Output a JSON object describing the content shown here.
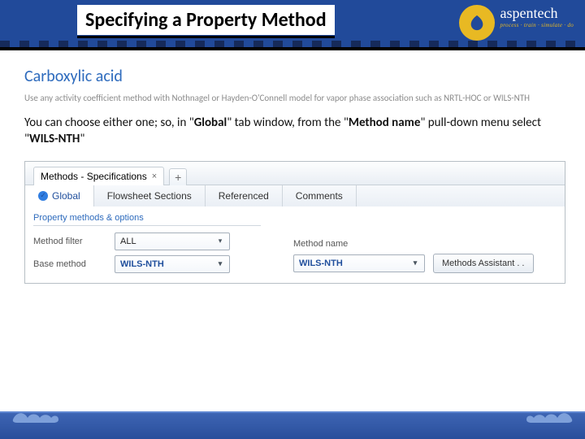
{
  "header": {
    "title": "Specifying a Property Method",
    "logo": {
      "brand": "aspentech",
      "tagline": "process · train · simulate · do"
    }
  },
  "section": {
    "title": "Carboxylic acid",
    "subtitle": "Use any activity coefficient method with Nothnagel or Hayden-O'Connell model for vapor phase association such as NRTL-HOC or WILS-NTH"
  },
  "instruction": {
    "pre": "You can choose either one; so, in \"",
    "b1": "Global",
    "mid1": "\" tab window, from the \"",
    "b2": "Method name",
    "mid2": "\" pull-down menu select \"",
    "b3": "WILS-NTH",
    "post": "\""
  },
  "app": {
    "doc_tab": "Methods - Specifications",
    "close_glyph": "×",
    "plus_glyph": "+",
    "tabs": {
      "global": "Global",
      "flowsheet": "Flowsheet Sections",
      "referenced": "Referenced",
      "comments": "Comments"
    },
    "left": {
      "group": "Property methods & options",
      "filter_label": "Method filter",
      "filter_value": "ALL",
      "base_label": "Base method",
      "base_value": "WILS-NTH"
    },
    "right": {
      "name_label": "Method name",
      "name_value": "WILS-NTH",
      "assistant": "Methods Assistant . ."
    },
    "caret": "▾",
    "check_glyph": "✓"
  }
}
